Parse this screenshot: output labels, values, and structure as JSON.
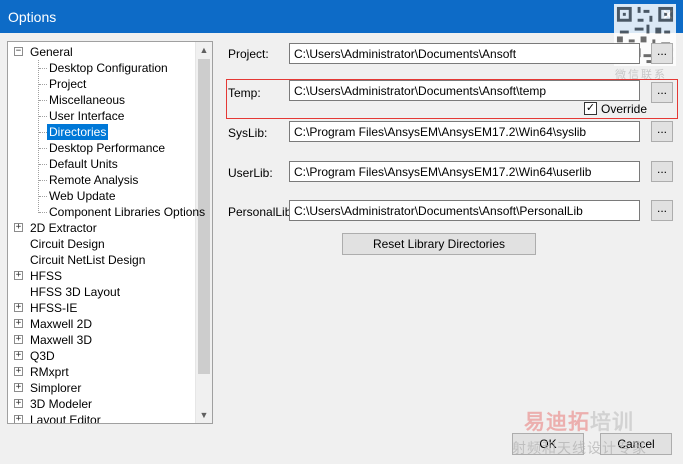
{
  "window": {
    "title": "Options",
    "close_glyph": "✕"
  },
  "tree": {
    "items": [
      {
        "label": "General",
        "level": 0,
        "expander": "−"
      },
      {
        "label": "Desktop Configuration",
        "level": 1
      },
      {
        "label": "Project",
        "level": 1
      },
      {
        "label": "Miscellaneous",
        "level": 1
      },
      {
        "label": "User Interface",
        "level": 1
      },
      {
        "label": "Directories",
        "level": 1,
        "selected": true
      },
      {
        "label": "Desktop Performance",
        "level": 1
      },
      {
        "label": "Default Units",
        "level": 1
      },
      {
        "label": "Remote Analysis",
        "level": 1
      },
      {
        "label": "Web Update",
        "level": 1
      },
      {
        "label": "Component Libraries Options",
        "level": 1
      },
      {
        "label": "2D Extractor",
        "level": 0,
        "expander": "+"
      },
      {
        "label": "Circuit Design",
        "level": 0
      },
      {
        "label": "Circuit NetList Design",
        "level": 0
      },
      {
        "label": "HFSS",
        "level": 0,
        "expander": "+"
      },
      {
        "label": "HFSS 3D Layout",
        "level": 0
      },
      {
        "label": "HFSS-IE",
        "level": 0,
        "expander": "+"
      },
      {
        "label": "Maxwell 2D",
        "level": 0,
        "expander": "+"
      },
      {
        "label": "Maxwell 3D",
        "level": 0,
        "expander": "+"
      },
      {
        "label": "Q3D",
        "level": 0,
        "expander": "+"
      },
      {
        "label": "RMxprt",
        "level": 0,
        "expander": "+"
      },
      {
        "label": "Simplorer",
        "level": 0,
        "expander": "+"
      },
      {
        "label": "3D Modeler",
        "level": 0,
        "expander": "+"
      },
      {
        "label": "Layout Editor",
        "level": 0,
        "expander": "+"
      }
    ]
  },
  "directories": {
    "project": {
      "label": "Project:",
      "value": "C:\\Users\\Administrator\\Documents\\Ansoft"
    },
    "temp": {
      "label": "Temp:",
      "value": "C:\\Users\\Administrator\\Documents\\Ansoft\\temp",
      "override_label": "Override",
      "override_checked": "✓"
    },
    "syslib": {
      "label": "SysLib:",
      "value": "C:\\Program Files\\AnsysEM\\AnsysEM17.2\\Win64\\syslib"
    },
    "userlib": {
      "label": "UserLib:",
      "value": "C:\\Program Files\\AnsysEM\\AnsysEM17.2\\Win64\\userlib"
    },
    "personallib": {
      "label": "PersonalLib:",
      "value": "C:\\Users\\Administrator\\Documents\\Ansoft\\PersonalLib"
    },
    "browse_label": "..."
  },
  "buttons": {
    "reset": "Reset Library Directories",
    "ok": "OK",
    "cancel": "Cancel"
  },
  "watermark": {
    "qr_caption": "微信联系",
    "brand_red": "易迪拓",
    "brand_gray": "培训",
    "slogan": "射频和天线设计专家"
  },
  "scrollbar": {
    "up_glyph": "▲",
    "down_glyph": "▼"
  }
}
